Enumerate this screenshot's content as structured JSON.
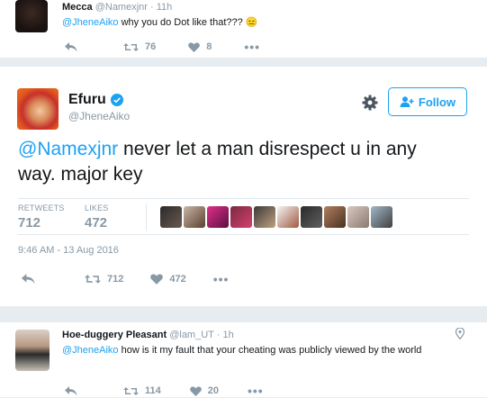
{
  "reply_top": {
    "name": "Mecca",
    "handle": "@Namexjnr",
    "time": "· 11h",
    "mention": "@JheneAiko",
    "text": " why you do Dot like that??? 😑",
    "retweets": "76",
    "likes": "8",
    "more": "•••"
  },
  "main_tweet": {
    "name": "Efuru",
    "handle": "@JheneAiko",
    "verified_icon": "verified-badge-icon",
    "follow_label": "Follow",
    "mention": "@Namexjnr",
    "text": " never let a man disrespect u in any way. major key",
    "stats": {
      "retweets_label": "RETWEETS",
      "retweets_count": "712",
      "likes_label": "LIKES",
      "likes_count": "472"
    },
    "timestamp": "9:46 AM - 13 Aug 2016",
    "action_retweets": "712",
    "action_likes": "472",
    "more": "•••"
  },
  "reply_bottom": {
    "name": "Hoe-duggery Pleasant",
    "handle": "@lam_UT",
    "time": "· 1h",
    "mention": "@JheneAiko",
    "text": " how is it my fault that your cheating was publicly viewed by the world",
    "retweets": "114",
    "likes": "20",
    "more": "•••"
  },
  "colors": {
    "twitter_blue": "#1da1f2",
    "muted_gray": "#8899a6",
    "background": "#e6ecf0"
  },
  "icons": [
    "reply-icon",
    "retweet-icon",
    "heart-icon",
    "more-icon",
    "gear-icon",
    "follow-person-icon",
    "location-pin-icon",
    "verified-badge-icon"
  ]
}
